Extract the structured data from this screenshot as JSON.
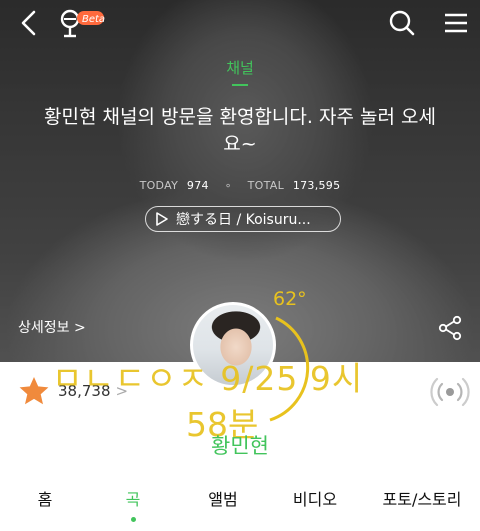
{
  "header": {
    "back_icon": "chevron-left-icon",
    "logo_icon": "microphone-logo-icon",
    "logo_badge": "Beta",
    "search_icon": "search-icon",
    "menu_icon": "hamburger-menu-icon"
  },
  "channel": {
    "label": "채널",
    "welcome_text": "황민현 채널의 방문을 환영합니다. 자주 놀러 오세요~",
    "today_label": "TODAY",
    "today_value": "974",
    "total_label": "TOTAL",
    "total_value": "173,595",
    "now_playing": "戀する日 / Koisuru..."
  },
  "profile": {
    "detail_link": "상세정보 >",
    "temperature": "62°",
    "overlay_line1": "ㅁㄴㄷㅇㅈ 9/25 9시",
    "overlay_line2": "58분",
    "artist_name": "황민현",
    "fan_count": "38,738",
    "fan_chevron": ">",
    "accent_color": "#42c45c",
    "overlay_color": "#e8c21e"
  },
  "tabs": [
    {
      "label": "홈"
    },
    {
      "label": "곡",
      "active": true
    },
    {
      "label": "앨범"
    },
    {
      "label": "비디오"
    },
    {
      "label": "포토/스토리"
    }
  ]
}
